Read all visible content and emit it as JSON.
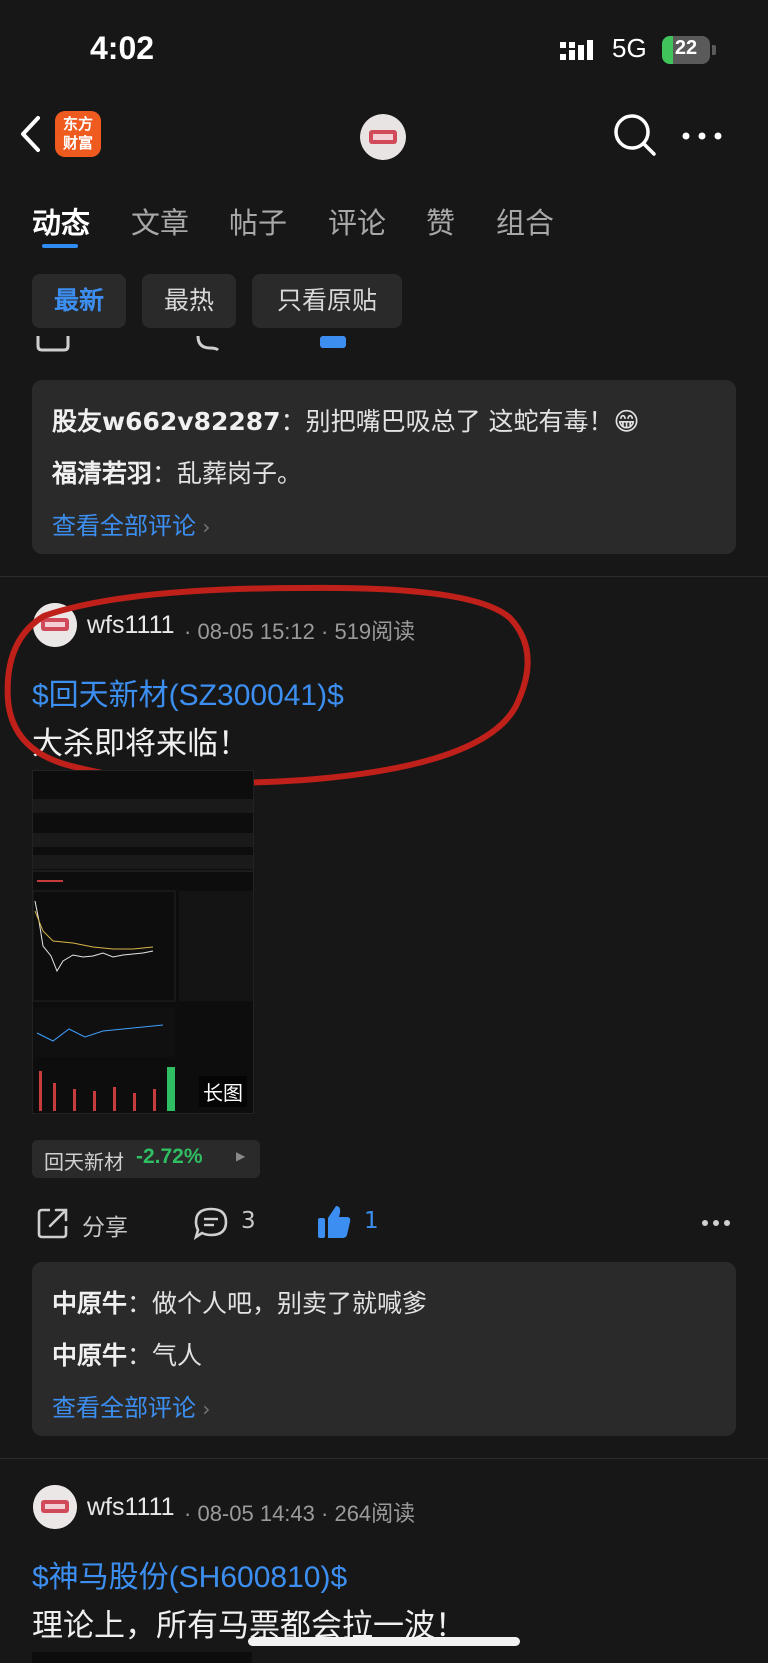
{
  "status_bar": {
    "time": "4:02",
    "network": "5G",
    "battery": "22"
  },
  "nav": {
    "logo_text": "东方\n财富",
    "logo_line1": "东方",
    "logo_line2": "财富"
  },
  "tabs": [
    {
      "label": "动态",
      "active": true
    },
    {
      "label": "文章",
      "active": false
    },
    {
      "label": "帖子",
      "active": false
    },
    {
      "label": "评论",
      "active": false
    },
    {
      "label": "赞",
      "active": false
    },
    {
      "label": "组合",
      "active": false
    }
  ],
  "filters": [
    {
      "label": "最新",
      "active": true
    },
    {
      "label": "最热",
      "active": false
    },
    {
      "label": "只看原贴",
      "active": false
    }
  ],
  "prev_post": {
    "comments": [
      {
        "user": "股友w662v82287",
        "text": "别把嘴巴吸总了 这蛇有毒！😁"
      },
      {
        "user": "福清若羽",
        "text": "乱葬岗子。"
      }
    ],
    "view_all": "查看全部评论"
  },
  "post1": {
    "author": "wfs1111",
    "time": "08-05 15:12",
    "reads": "519阅读",
    "stock_tag": "$回天新材(SZ300041)$",
    "text": "大杀即将来临！",
    "image_label": "长图",
    "stock_chip": {
      "name": "回天新材",
      "change": "-2.72%"
    },
    "actions": {
      "share": "分享",
      "comments": "3",
      "likes": "1"
    },
    "comments": [
      {
        "user": "中原牛",
        "text": "做个人吧，别卖了就喊爹"
      },
      {
        "user": "中原牛",
        "text": "气人"
      }
    ],
    "view_all": "查看全部评论"
  },
  "post2": {
    "author": "wfs1111",
    "time": "08-05 14:43",
    "reads": "264阅读",
    "stock_tag": "$神马股份(SH600810)$",
    "text": "理论上，所有马票都会拉一波！"
  },
  "colors": {
    "accent": "#3c8ff0",
    "down": "#2fbf62",
    "annotation": "#c0201a"
  }
}
